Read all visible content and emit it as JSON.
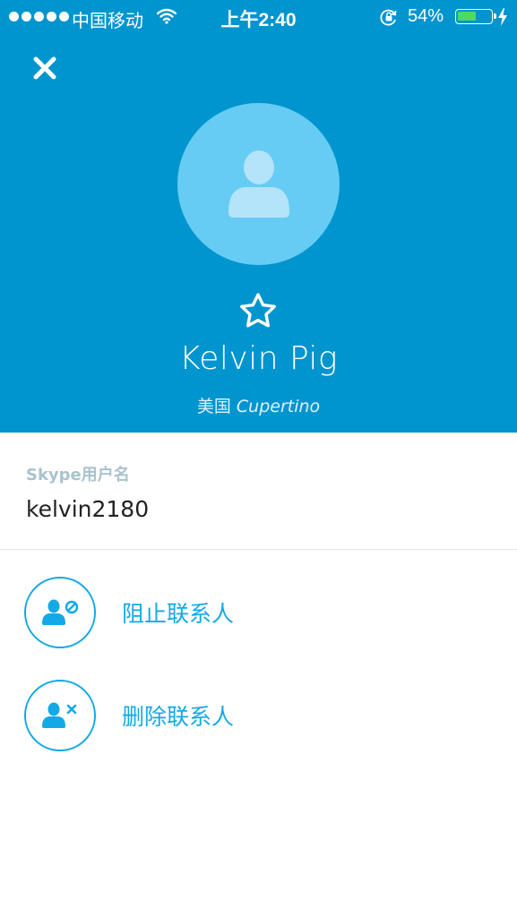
{
  "status_bar": {
    "carrier": "中国移动",
    "time": "上午2:40",
    "battery_percent": "54%",
    "battery_level": 0.54
  },
  "contact": {
    "name": "Kelvin Pig",
    "country": "美国",
    "city": "Cupertino"
  },
  "username": {
    "label": "Skype用户名",
    "value": "kelvin2180"
  },
  "actions": [
    {
      "label": "阻止联系人",
      "icon": "block-contact-icon"
    },
    {
      "label": "删除联系人",
      "icon": "remove-contact-icon"
    }
  ],
  "colors": {
    "header_bg": "#0095cf",
    "avatar_bg": "#66ccf4",
    "accent": "#13a9e6",
    "label_gray": "#a9c3ce"
  }
}
